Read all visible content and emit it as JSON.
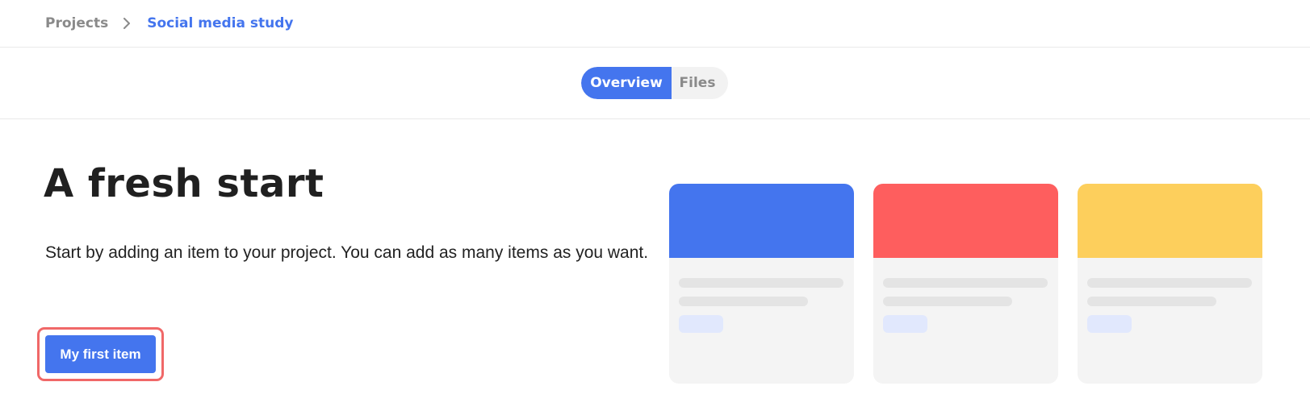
{
  "breadcrumb": {
    "root": "Projects",
    "current": "Social media study",
    "separator_icon": "chevron-right-icon"
  },
  "tabs": [
    {
      "label": "Overview",
      "active": true
    },
    {
      "label": "Files",
      "active": false
    }
  ],
  "hero": {
    "title": "A fresh start",
    "description": "Start by adding an item to your project. You can add as many items as you want.",
    "button_label": "My first item"
  },
  "preview_cards": [
    {
      "header_color": "#4475ee"
    },
    {
      "header_color": "#fe5e5e"
    },
    {
      "header_color": "#fdcf5c"
    }
  ],
  "colors": {
    "accent": "#4475ee",
    "highlight_ring": "#f06868",
    "muted_text": "#8a8a8a"
  }
}
